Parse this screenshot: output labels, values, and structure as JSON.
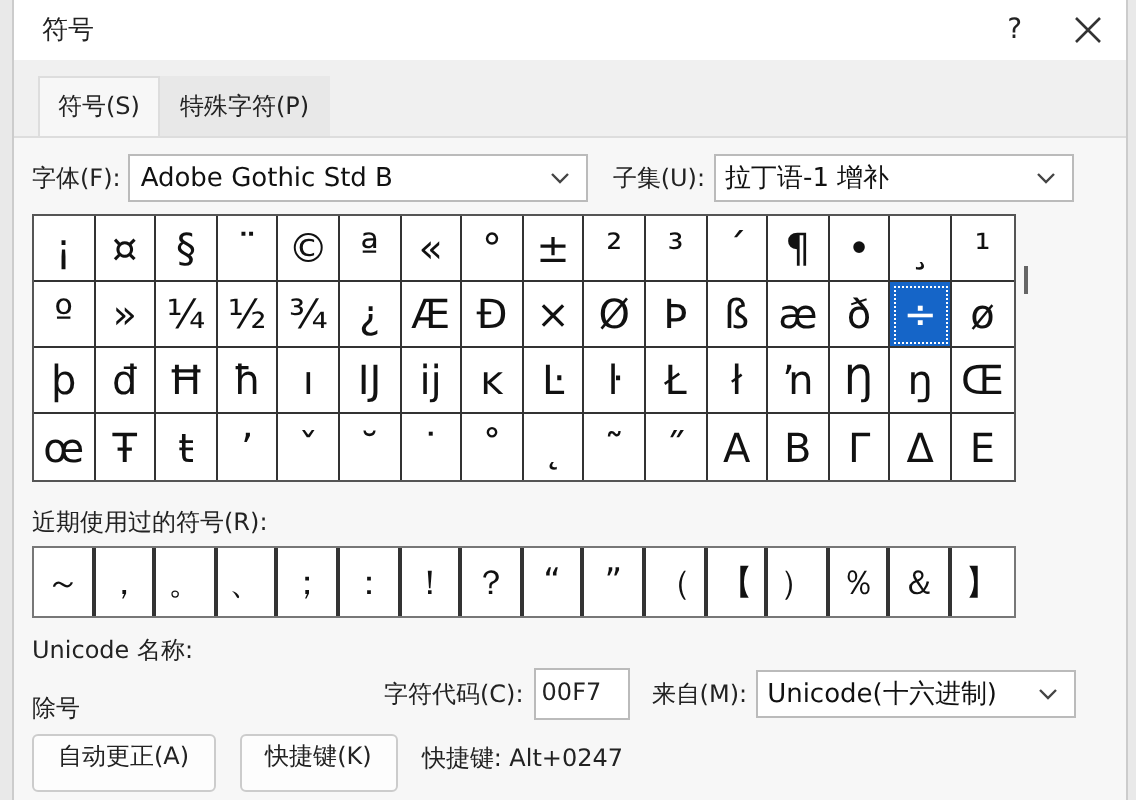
{
  "window": {
    "title": "符号",
    "help": "?"
  },
  "tabs": [
    {
      "label": "符号(S)",
      "selected": true
    },
    {
      "label": "特殊字符(P)",
      "selected": false
    }
  ],
  "font": {
    "label": "字体(F):",
    "value": "Adobe Gothic Std B"
  },
  "subset": {
    "label": "子集(U):",
    "value": "拉丁语-1 增补"
  },
  "symbol_grid": {
    "rows": [
      {
        "cells": [
          {
            "char": "¡",
            "selected": false
          },
          {
            "char": "¤",
            "selected": false
          },
          {
            "char": "§",
            "selected": false
          },
          {
            "char": "¨",
            "selected": false
          },
          {
            "char": "©",
            "selected": false
          },
          {
            "char": "ª",
            "selected": false
          },
          {
            "char": "«",
            "selected": false
          },
          {
            "char": "°",
            "selected": false
          },
          {
            "char": "±",
            "selected": false
          },
          {
            "char": "²",
            "selected": false
          },
          {
            "char": "³",
            "selected": false
          },
          {
            "char": "´",
            "selected": false
          },
          {
            "char": "¶",
            "selected": false
          },
          {
            "char": "•",
            "selected": false
          },
          {
            "char": "¸",
            "selected": false
          },
          {
            "char": "¹",
            "selected": false
          }
        ]
      },
      {
        "cells": [
          {
            "char": "º",
            "selected": false
          },
          {
            "char": "»",
            "selected": false
          },
          {
            "char": "¼",
            "selected": false
          },
          {
            "char": "½",
            "selected": false
          },
          {
            "char": "¾",
            "selected": false
          },
          {
            "char": "¿",
            "selected": false
          },
          {
            "char": "Æ",
            "selected": false
          },
          {
            "char": "Đ",
            "selected": false
          },
          {
            "char": "×",
            "selected": false
          },
          {
            "char": "Ø",
            "selected": false
          },
          {
            "char": "Þ",
            "selected": false
          },
          {
            "char": "ß",
            "selected": false
          },
          {
            "char": "æ",
            "selected": false
          },
          {
            "char": "ð",
            "selected": false
          },
          {
            "char": "÷",
            "selected": true
          },
          {
            "char": "ø",
            "selected": false
          }
        ]
      },
      {
        "cells": [
          {
            "char": "þ",
            "selected": false
          },
          {
            "char": "đ",
            "selected": false
          },
          {
            "char": "Ħ",
            "selected": false
          },
          {
            "char": "ħ",
            "selected": false
          },
          {
            "char": "ı",
            "selected": false
          },
          {
            "char": "Ĳ",
            "selected": false
          },
          {
            "char": "ĳ",
            "selected": false
          },
          {
            "char": "ĸ",
            "selected": false
          },
          {
            "char": "Ŀ",
            "selected": false
          },
          {
            "char": "ŀ",
            "selected": false
          },
          {
            "char": "Ł",
            "selected": false
          },
          {
            "char": "ł",
            "selected": false
          },
          {
            "char": "ŉ",
            "selected": false
          },
          {
            "char": "Ŋ",
            "selected": false
          },
          {
            "char": "ŋ",
            "selected": false
          },
          {
            "char": "Œ",
            "selected": false
          }
        ]
      },
      {
        "cells": [
          {
            "char": "œ",
            "selected": false
          },
          {
            "char": "Ŧ",
            "selected": false
          },
          {
            "char": "ŧ",
            "selected": false
          },
          {
            "char": "ʼ",
            "selected": false
          },
          {
            "char": "ˇ",
            "selected": false
          },
          {
            "char": "˘",
            "selected": false
          },
          {
            "char": "˙",
            "selected": false
          },
          {
            "char": "˚",
            "selected": false
          },
          {
            "char": "˛",
            "selected": false
          },
          {
            "char": "˜",
            "selected": false
          },
          {
            "char": "˝",
            "selected": false
          },
          {
            "char": "Α",
            "selected": false
          },
          {
            "char": "Β",
            "selected": false
          },
          {
            "char": "Γ",
            "selected": false
          },
          {
            "char": "Δ",
            "selected": false
          },
          {
            "char": "Ε",
            "selected": false
          }
        ]
      }
    ]
  },
  "recent_label": "近期使用过的符号(R):",
  "recent_symbols": [
    "～",
    "，",
    "。",
    "、",
    "；",
    "：",
    "！",
    "？",
    "“",
    "”",
    "（",
    "【",
    "）",
    "％",
    "＆",
    "】"
  ],
  "unicode_name_label": "Unicode 名称:",
  "unicode_name": "除号",
  "char_code": {
    "label": "字符代码(C):",
    "value": "00F7"
  },
  "from": {
    "label": "来自(M):",
    "value": "Unicode(十六进制)"
  },
  "buttons": [
    "自动更正(A)",
    "快捷键(K)"
  ],
  "shortcut_text": "快捷键: Alt+0247"
}
